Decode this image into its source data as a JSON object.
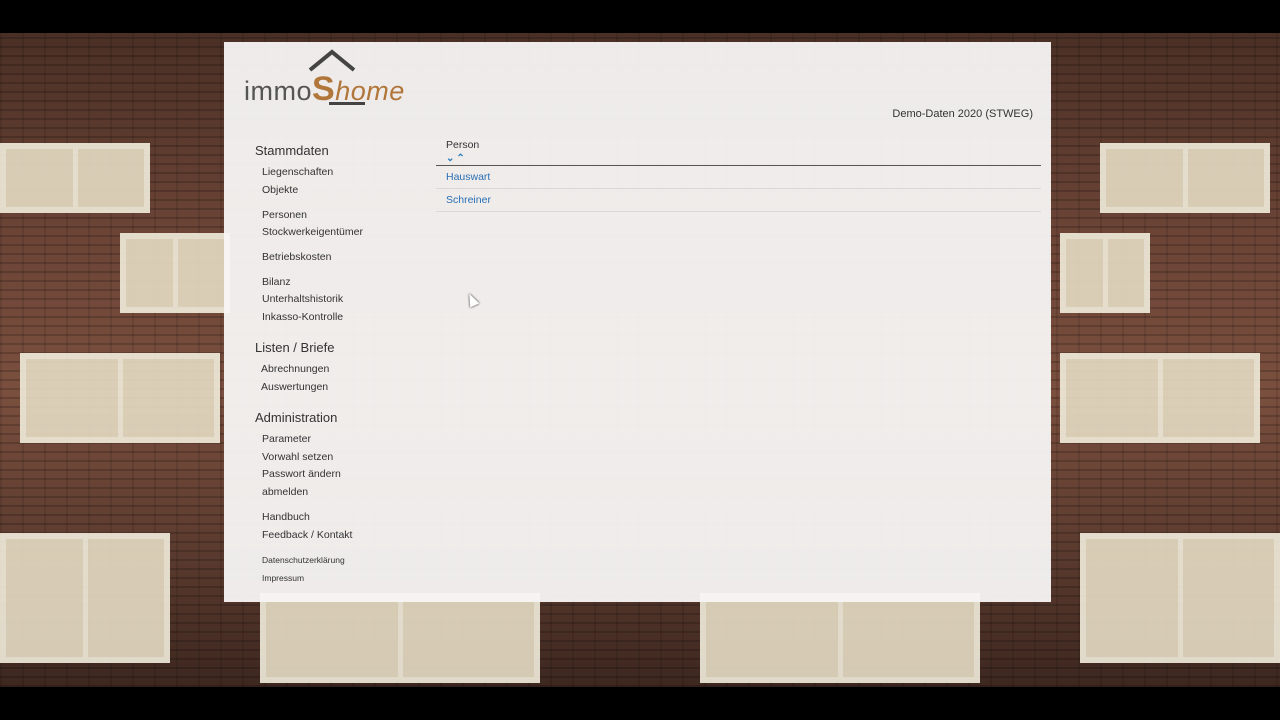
{
  "brand": {
    "part1": "immo",
    "part2": "S",
    "part3": "home"
  },
  "dataset_label": "Demo-Daten 2020 (STWEG)",
  "nav": {
    "stammdaten": {
      "heading": "Stammdaten",
      "items": [
        "Liegenschaften",
        "Objekte",
        "Personen",
        "Stockwerkeigentümer",
        "Betriebskosten",
        "Bilanz",
        "Unterhaltshistorik",
        "Inkasso-Kontrolle"
      ]
    },
    "listen": {
      "heading": "Listen / Briefe",
      "items": [
        "Abrechnungen",
        "Auswertungen"
      ]
    },
    "administration": {
      "heading": "Administration",
      "items": [
        "Parameter",
        "Vorwahl setzen",
        "Passwort ändern",
        "abmelden",
        "Handbuch",
        "Feedback / Kontakt",
        "Datenschutzerklärung",
        "Impressum"
      ]
    }
  },
  "table": {
    "column": "Person",
    "sort_icons": "chevron-down / chevron-up",
    "rows": [
      "Hauswart",
      "Schreiner"
    ]
  },
  "colors": {
    "link": "#2a6fb5",
    "brand_accent": "#b0763a"
  }
}
